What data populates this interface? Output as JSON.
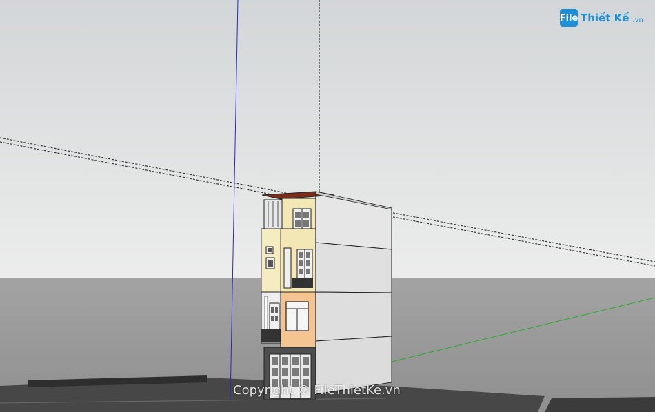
{
  "logo": {
    "badge": "File",
    "text": "Thiết Kế",
    "suffix": ".vn"
  },
  "watermark": {
    "text": "Copyright © FileThietKe.vn"
  },
  "colors": {
    "sky_top": "#d3d6d8",
    "sky_bottom": "#eaeceb",
    "ground": "#9b9b9b",
    "road": "#3f3f3f",
    "axis_blue": "#2a2ab8",
    "axis_green": "#2eaa2e",
    "facade_cream": "#f3e7b6",
    "facade_peach": "#f4c591",
    "facade_dark": "#555555",
    "side_wall": "#e3e3e3",
    "roof_brown": "#7a2e1a",
    "logo_blue": "#1e8fd6"
  },
  "icons": [
    "file-thietke-logo-icon"
  ]
}
